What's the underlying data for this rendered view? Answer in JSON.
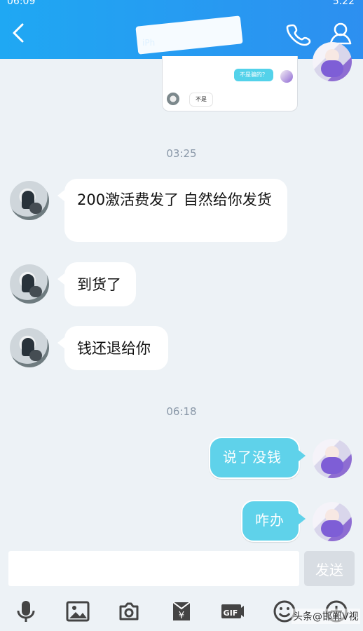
{
  "status_bar": {
    "left": "06:09",
    "right": "5.22"
  },
  "header": {
    "subtitle": "iPh"
  },
  "embedded_card": {
    "right_bubble": "不是骗的？",
    "left_bubble": "不是"
  },
  "timestamps": [
    "03:25",
    "06:18"
  ],
  "messages": [
    {
      "text": "200激活费发了 自然给你发货"
    },
    {
      "text": "到货了"
    },
    {
      "text": "钱还退给你"
    },
    {
      "text": "说了没钱"
    },
    {
      "text": "咋办"
    }
  ],
  "composer": {
    "send_label": "发送"
  },
  "toolbar": {
    "items": [
      "microphone-icon",
      "image-icon",
      "camera-icon",
      "red-packet-icon",
      "gif-icon",
      "emoji-icon",
      "plus-icon"
    ]
  },
  "watermark": "头条@邯郸V视"
}
